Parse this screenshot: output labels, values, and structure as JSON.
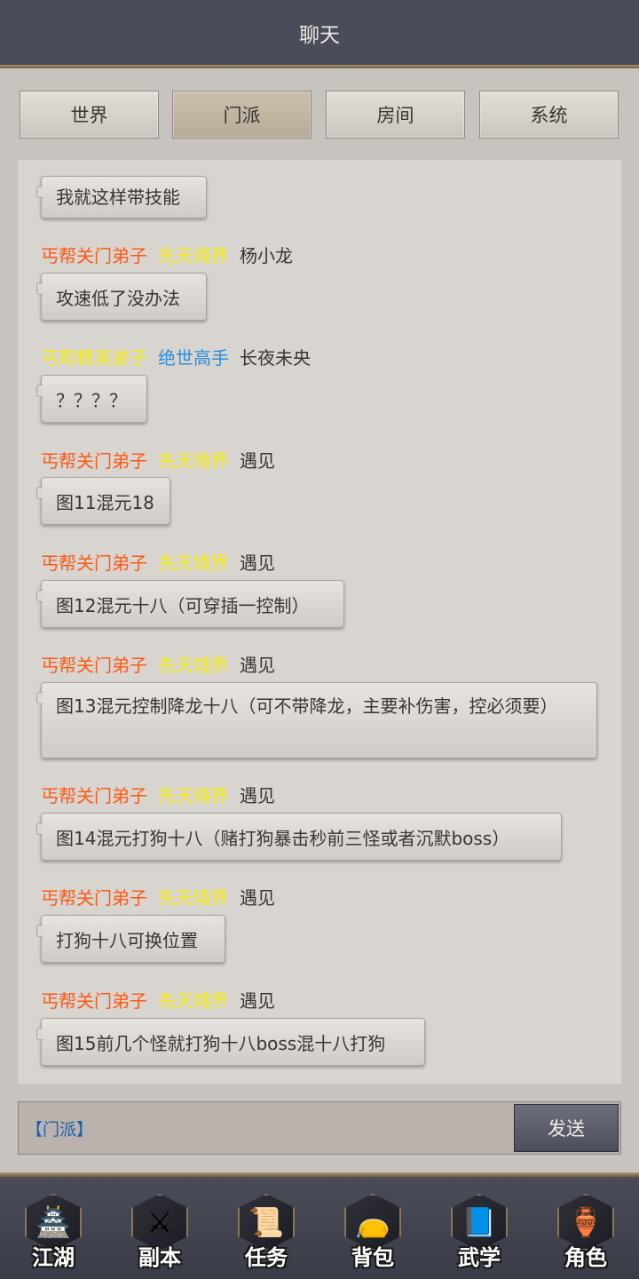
{
  "header": {
    "title": "聊天"
  },
  "tabs": [
    "世界",
    "门派",
    "房间",
    "系统"
  ],
  "messages": [
    {
      "text": "我就这样带技能"
    },
    {
      "sect": "丐帮关门弟子",
      "rank": "先天境界",
      "name": "杨小龙",
      "text": "攻速低了没办法"
    },
    {
      "sect": "丐帮精英弟子",
      "rank": "绝世高手",
      "name": "长夜未央",
      "text": "？？？？"
    },
    {
      "sect": "丐帮关门弟子",
      "rank": "先天境界",
      "name": "遇见",
      "text": "图11混元18"
    },
    {
      "sect": "丐帮关门弟子",
      "rank": "先天境界",
      "name": "遇见",
      "text": "图12混元十八（可穿插一控制）"
    },
    {
      "sect": "丐帮关门弟子",
      "rank": "先天境界",
      "name": "遇见",
      "text": "图13混元控制降龙十八（可不带降龙，主要补伤害，控必须要）"
    },
    {
      "sect": "丐帮关门弟子",
      "rank": "先天境界",
      "name": "遇见",
      "text": "图14混元打狗十八（赌打狗暴击秒前三怪或者沉默boss）"
    },
    {
      "sect": "丐帮关门弟子",
      "rank": "先天境界",
      "name": "遇见",
      "text": "打狗十八可换位置"
    },
    {
      "sect": "丐帮关门弟子",
      "rank": "先天境界",
      "name": "遇见",
      "text": "图15前几个怪就打狗十八boss混十八打狗"
    }
  ],
  "input": {
    "channel_prefix": "【门派】",
    "send_label": "发送"
  },
  "nav": [
    {
      "label": "江湖",
      "icon": "palace-icon"
    },
    {
      "label": "副本",
      "icon": "crossed-swords-icon"
    },
    {
      "label": "任务",
      "icon": "scroll-icon"
    },
    {
      "label": "背包",
      "icon": "pouch-icon"
    },
    {
      "label": "武学",
      "icon": "book-icon"
    },
    {
      "label": "角色",
      "icon": "gourd-icon"
    }
  ],
  "colors": {
    "header_bg": "#4a4c5a",
    "sect_orange": "#ff5a14",
    "sect_yellow": "#f3ec15",
    "rank_blue": "#2a8fe0",
    "accent_gold": "#a99473"
  }
}
